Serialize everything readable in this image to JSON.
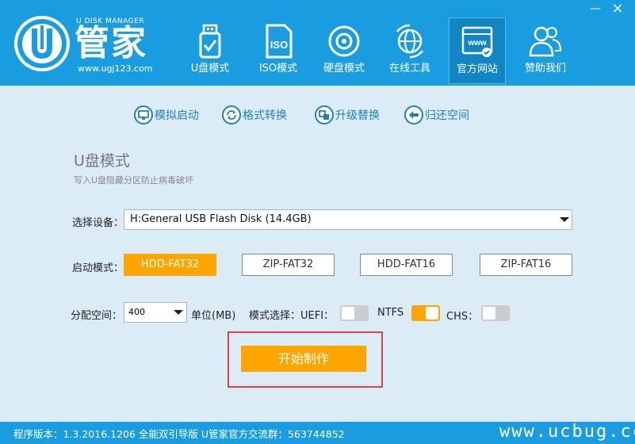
{
  "header": {
    "brand_en": "U DISK MANAGER",
    "brand_cn": "管家",
    "url": "www.ugj123.com",
    "nav": [
      {
        "label": "U盘模式",
        "icon": "usb-drive-icon",
        "active": false
      },
      {
        "label": "ISO模式",
        "icon": "iso-file-icon",
        "active": false
      },
      {
        "label": "硬盘模式",
        "icon": "hard-disk-icon",
        "active": false
      },
      {
        "label": "在线工具",
        "icon": "globe-icon",
        "active": false
      },
      {
        "label": "官方网站",
        "icon": "website-icon",
        "active": true
      },
      {
        "label": "赞助我们",
        "icon": "users-icon",
        "active": false
      }
    ],
    "window": {
      "minimize": "—",
      "close": "×"
    }
  },
  "subtoolbar": [
    {
      "label": "模拟启动",
      "icon": "monitor-icon"
    },
    {
      "label": "格式转换",
      "icon": "convert-icon"
    },
    {
      "label": "升级替换",
      "icon": "upgrade-icon"
    },
    {
      "label": "归还空间",
      "icon": "return-icon"
    }
  ],
  "panel": {
    "title": "U盘模式",
    "desc": "写入U盘隐藏分区防止病毒破坏",
    "device_label": "选择设备：",
    "device_value": "H:General USB Flash Disk (14.4GB)",
    "boot_label": "启动模式：",
    "boot_modes": [
      "HDD-FAT32",
      "ZIP-FAT32",
      "HDD-FAT16",
      "ZIP-FAT16"
    ],
    "boot_selected": "HDD-FAT32",
    "alloc_label": "分配空间：",
    "alloc_value": "400",
    "unit_label": "单位(MB)",
    "mode_label": "模式选择：UEFI：",
    "ntfs_label": "NTFS",
    "chs_label": "CHS：",
    "toggles": {
      "uefi": false,
      "ntfs": true,
      "chs": false
    },
    "start_label": "开始制作"
  },
  "footer": {
    "version": "程序版本：1.3.2016.1206 全能双引导版 U管家官方交流群：563744852",
    "watermark": "www.ucbug.cc"
  },
  "colors": {
    "header_bg": "#1a9de0",
    "panel_bg": "#dcecf7",
    "accent": "#ffa500",
    "highlight_border": "#e0404a"
  }
}
